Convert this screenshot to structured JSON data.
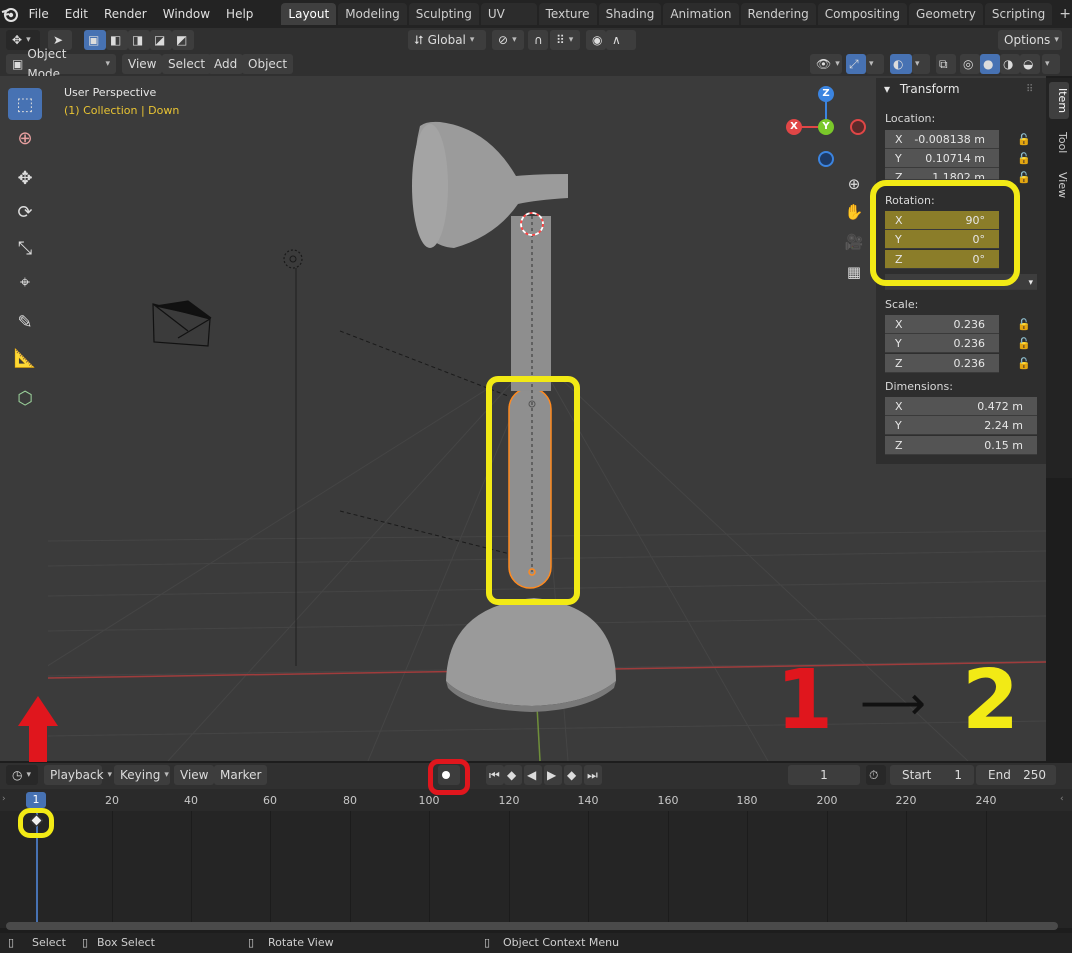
{
  "menubar": {
    "menus": [
      "File",
      "Edit",
      "Render",
      "Window",
      "Help"
    ],
    "workspaces": [
      "Layout",
      "Modeling",
      "Sculpting",
      "UV Editing",
      "Texture Paint",
      "Shading",
      "Animation",
      "Rendering",
      "Compositing",
      "Geometry Nodes",
      "Scripting"
    ],
    "active_workspace": "Layout",
    "add_tab": "+"
  },
  "header": {
    "transform_orientation": "Global",
    "options_label": "Options",
    "mode_label": "Object Mode",
    "menus": [
      "View",
      "Select",
      "Add",
      "Object"
    ]
  },
  "viewport": {
    "perspective_label": "User Perspective",
    "collection_label": "(1) Collection | Down",
    "gizmo": {
      "z": "Z",
      "y": "Y",
      "x": "X"
    }
  },
  "npanel": {
    "section_title": "Transform",
    "location_label": "Location:",
    "location": [
      {
        "axis": "X",
        "value": "-0.008138 m"
      },
      {
        "axis": "Y",
        "value": "0.10714 m"
      },
      {
        "axis": "Z",
        "value": "1.1802 m"
      }
    ],
    "rotation_label": "Rotation:",
    "rotation": [
      {
        "axis": "X",
        "value": "90°"
      },
      {
        "axis": "Y",
        "value": "0°"
      },
      {
        "axis": "Z",
        "value": "0°"
      }
    ],
    "scale_label": "Scale:",
    "scale": [
      {
        "axis": "X",
        "value": "0.236"
      },
      {
        "axis": "Y",
        "value": "0.236"
      },
      {
        "axis": "Z",
        "value": "0.236"
      }
    ],
    "dimensions_label": "Dimensions:",
    "dimensions": [
      {
        "axis": "X",
        "value": "0.472 m"
      },
      {
        "axis": "Y",
        "value": "2.24 m"
      },
      {
        "axis": "Z",
        "value": "0.15 m"
      }
    ],
    "tabs": [
      "Item",
      "Tool",
      "View"
    ],
    "active_tab": "Item"
  },
  "timeline": {
    "menus": [
      "Playback",
      "Keying",
      "View",
      "Marker"
    ],
    "current_frame": "1",
    "start_label": "Start",
    "start_value": "1",
    "end_label": "End",
    "end_value": "250",
    "frame_indicator": "1",
    "ticks": [
      "20",
      "40",
      "60",
      "80",
      "100",
      "120",
      "140",
      "160",
      "180",
      "200",
      "220",
      "240"
    ]
  },
  "statusbar": {
    "select": "Select",
    "box_select": "Box Select",
    "rotate_view": "Rotate View",
    "context_menu": "Object Context Menu"
  },
  "annotations": {
    "step1": "1",
    "step2": "2",
    "arrow": "⟶"
  },
  "colors": {
    "highlight_yellow": "#f2ea15",
    "record_red": "#e0161d",
    "selection_orange": "#ff8a1f",
    "accent_blue": "#4772b3"
  }
}
